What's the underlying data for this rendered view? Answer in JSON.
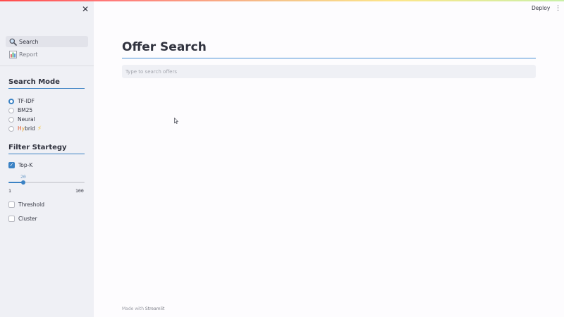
{
  "sidebar": {
    "nav": [
      {
        "label": "Search",
        "icon": "magnifier-icon",
        "active": true
      },
      {
        "label": "Report",
        "icon": "bar-chart-icon",
        "active": false
      }
    ],
    "search_mode": {
      "title": "Search Mode",
      "options": [
        {
          "label": "TF-IDF",
          "checked": true
        },
        {
          "label": "BM25",
          "checked": false
        },
        {
          "label": "Neural",
          "checked": false
        },
        {
          "label_h": "H",
          "label_y": "y",
          "label_rest": "brid",
          "emoji": "⚡",
          "checked": false
        }
      ]
    },
    "filter": {
      "title": "Filter Startegy",
      "topk": {
        "label": "Top-K",
        "checked": true
      },
      "slider": {
        "value": "20",
        "min": "1",
        "max": "100"
      },
      "threshold": {
        "label": "Threshold",
        "checked": false
      },
      "cluster": {
        "label": "Cluster",
        "checked": false
      }
    }
  },
  "header": {
    "deploy_label": "Deploy"
  },
  "main": {
    "title": "Offer Search",
    "search": {
      "placeholder": "Type to search offers",
      "value": ""
    }
  },
  "footer": {
    "prefix": "Made with ",
    "brand": "Streamlit"
  },
  "colors": {
    "accent": "#3b82c4",
    "sidebar_bg": "#eff0f5"
  }
}
